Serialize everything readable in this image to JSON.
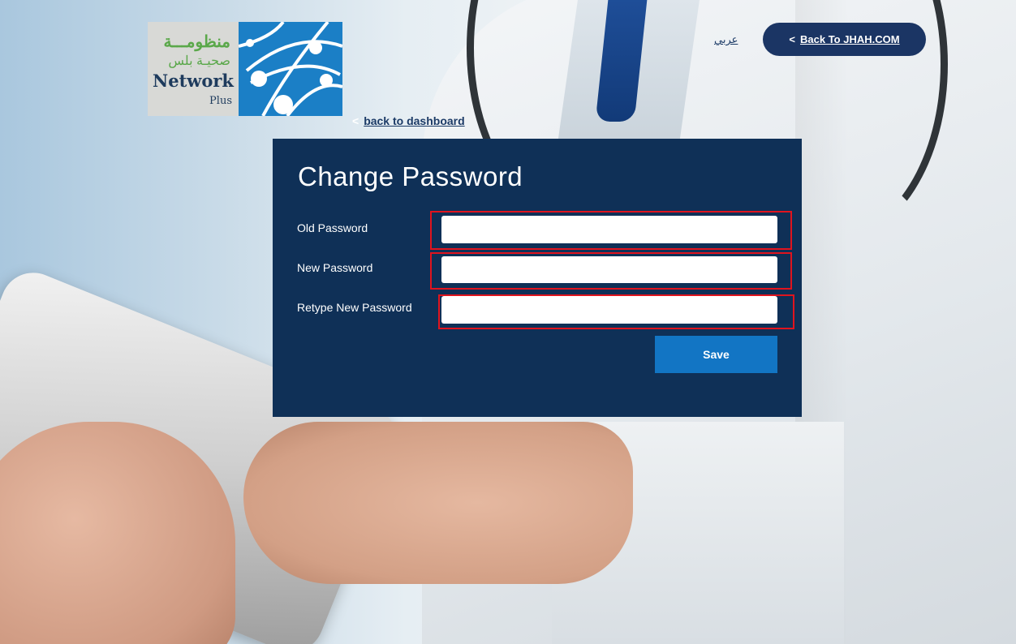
{
  "header": {
    "logo": {
      "arabic_line1": "منظومـــة",
      "arabic_line2": "صحيـة بلس",
      "name": "Network",
      "suffix": "Plus"
    },
    "back_dashboard_label": "back to dashboard",
    "language_toggle": "عربي",
    "back_to_site_label": "Back To JHAH.COM"
  },
  "form": {
    "title": "Change Password",
    "fields": [
      {
        "label": "Old Password",
        "value": ""
      },
      {
        "label": "New Password",
        "value": ""
      },
      {
        "label": "Retype New Password",
        "value": ""
      }
    ],
    "save_label": "Save"
  },
  "colors": {
    "panel": "#0f3057",
    "button": "#1275c4",
    "pill": "#1b3564",
    "highlight": "#e0141e"
  }
}
